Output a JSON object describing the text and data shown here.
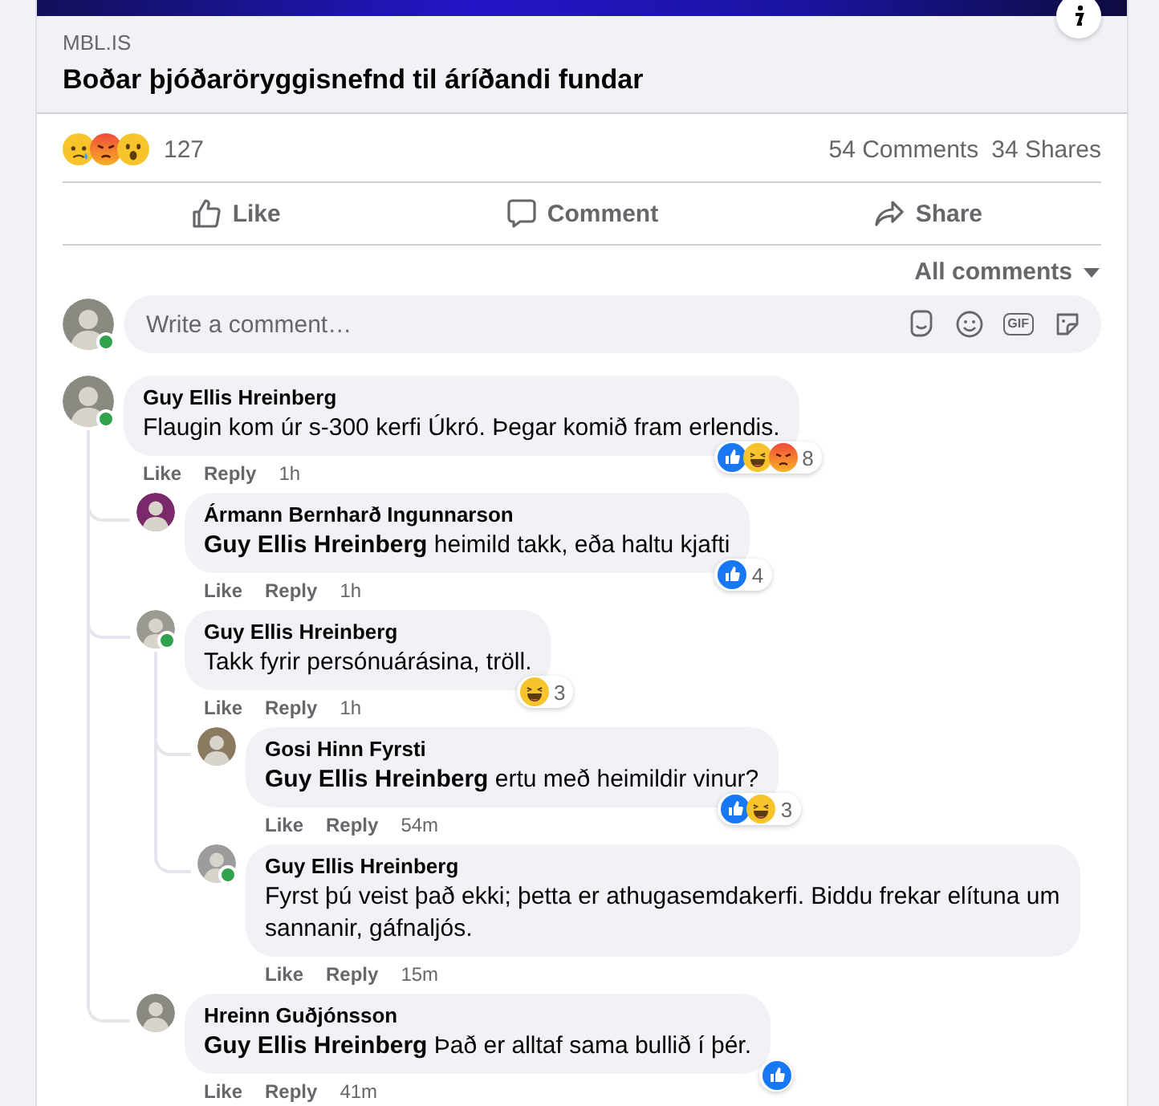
{
  "link_preview": {
    "source": "MBL.IS",
    "title": "Boðar þjóðaröryggisnefnd til áríðandi fundar"
  },
  "post_stats": {
    "reactions": [
      {
        "kind": "sad"
      },
      {
        "kind": "angry"
      },
      {
        "kind": "wow"
      }
    ],
    "reaction_count": "127",
    "comments": "54 Comments",
    "shares": "34 Shares"
  },
  "actions": [
    {
      "kind": "like",
      "label": "Like"
    },
    {
      "kind": "comment",
      "label": "Comment"
    },
    {
      "kind": "share",
      "label": "Share"
    }
  ],
  "sort": {
    "label": "All comments"
  },
  "composer": {
    "placeholder": "Write a comment…",
    "online": true,
    "gif_label": "GIF"
  },
  "comments": [
    {
      "author": "Guy Ellis Hreinberg",
      "text": "Flaugin kom úr s-300 kerfi Úkró. Þegar komið fram erlendis.",
      "online": true,
      "like": "Like",
      "reply": "Reply",
      "time": "1h",
      "reactions": [
        {
          "kind": "like"
        },
        {
          "kind": "haha"
        },
        {
          "kind": "angry"
        }
      ],
      "reaction_count": "8",
      "children": [
        {
          "author": "Ármann Bernharð Ingunnarson",
          "text": "**Guy Ellis Hreinberg** heimild takk, eða haltu kjafti",
          "like": "Like",
          "reply": "Reply",
          "time": "1h",
          "reactions": [
            {
              "kind": "like"
            }
          ],
          "reaction_count": "4"
        },
        {
          "author": "Guy Ellis Hreinberg",
          "text": "Takk fyrir persónuárásina, tröll.",
          "online": true,
          "like": "Like",
          "reply": "Reply",
          "time": "1h",
          "reactions": [
            {
              "kind": "haha"
            }
          ],
          "reaction_count": "3",
          "children": [
            {
              "author": "Gosi Hinn Fyrsti",
              "text": "**Guy Ellis Hreinberg** ertu með heimildir vinur?",
              "like": "Like",
              "reply": "Reply",
              "time": "54m",
              "reactions": [
                {
                  "kind": "like"
                },
                {
                  "kind": "haha"
                }
              ],
              "reaction_count": "3"
            },
            {
              "author": "Guy Ellis Hreinberg",
              "text": "Fyrst þú veist það ekki; þetta er athugasemdakerfi. Biddu frekar elítuna um sannanir, gáfnaljós.",
              "online": true,
              "like": "Like",
              "reply": "Reply",
              "time": "15m"
            }
          ]
        },
        {
          "author": "Hreinn Guðjónsson",
          "text": "**Guy Ellis Hreinberg** Það er alltaf sama bullið í þér.",
          "like": "Like",
          "reply": "Reply",
          "time": "41m",
          "reactions": [
            {
              "kind": "like"
            }
          ]
        }
      ]
    }
  ]
}
